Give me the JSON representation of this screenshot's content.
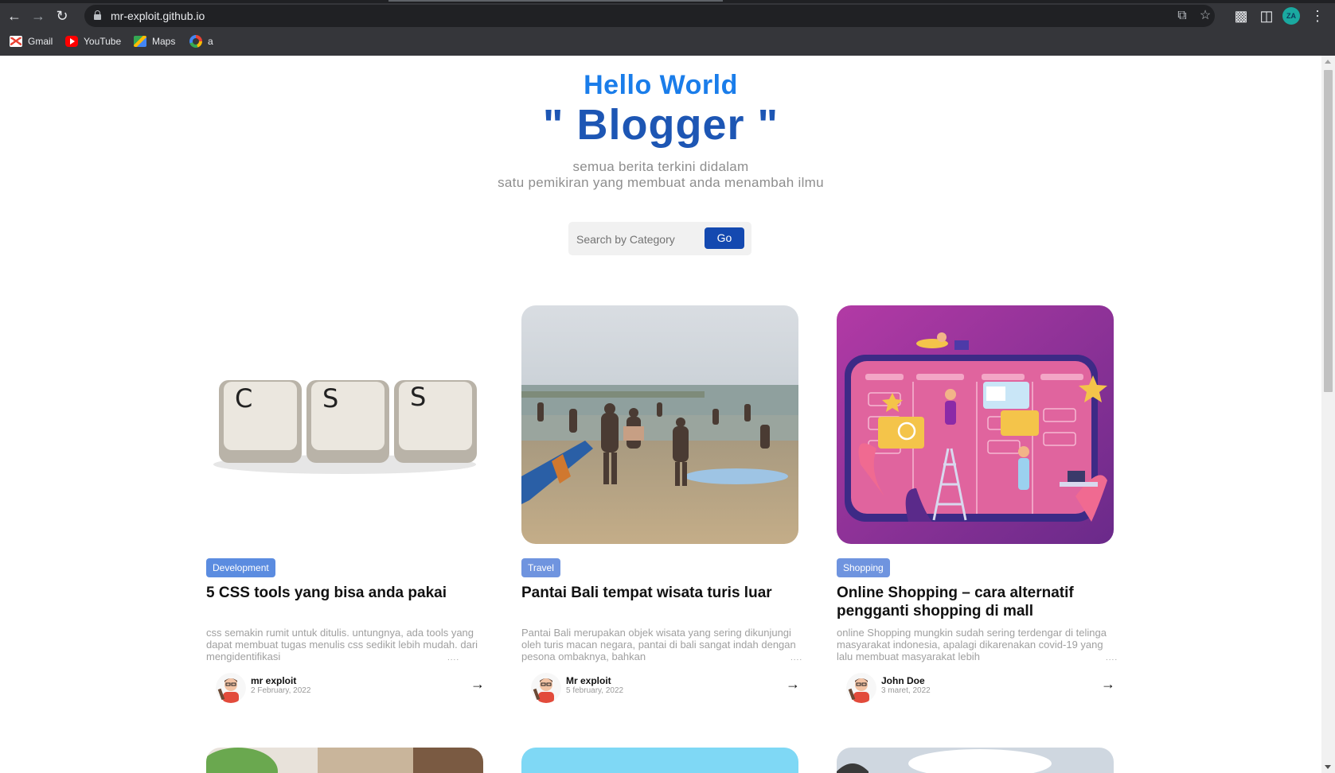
{
  "browser": {
    "url": "mr-exploit.github.io",
    "profile_initials": "ZA",
    "bookmarks": [
      {
        "label": "Gmail",
        "icon": "gmail-icon"
      },
      {
        "label": "YouTube",
        "icon": "youtube-icon"
      },
      {
        "label": "Maps",
        "icon": "maps-icon"
      },
      {
        "label": "a",
        "icon": "google-icon"
      }
    ]
  },
  "hero": {
    "subtitle": "Hello World",
    "title": "\" Blogger \"",
    "description_line1": "semua berita terkini didalam",
    "description_line2": "satu pemikiran yang membuat anda menambah ilmu"
  },
  "search": {
    "placeholder": "Search by Category",
    "button_label": "Go"
  },
  "posts": [
    {
      "tag": "Development",
      "tag_color": "#5b8ce0",
      "title": "5 CSS tools yang bisa anda pakai",
      "excerpt": "css semakin rumit untuk ditulis. untungnya, ada tools yang dapat membuat tugas menulis css sedikit lebih mudah. dari mengidentifikasi",
      "author": "mr exploit",
      "date": "2 February, 2022",
      "image": "css-keycaps"
    },
    {
      "tag": "Travel",
      "tag_color": "#6f94df",
      "title": "Pantai Bali tempat wisata turis luar",
      "excerpt": "Pantai Bali merupakan objek wisata yang sering dikunjungi oleh turis macan negara, pantai di bali sangat indah dengan pesona ombaknya, bahkan",
      "author": "Mr exploit",
      "date": "5 february, 2022",
      "image": "bali-beach"
    },
    {
      "tag": "Shopping",
      "tag_color": "#6f94df",
      "title": "Online Shopping – cara alternatif pengganti shopping di mall",
      "excerpt": "online Shopping mungkin sudah sering terdengar di telinga masyarakat indonesia, apalagi dikarenakan covid-19 yang lalu membuat masyarakat lebih",
      "author": "John Doe",
      "date": "3 maret, 2022",
      "image": "online-shopping-illustration"
    }
  ],
  "excerpt_ellipsis": "....",
  "arrow": "→"
}
